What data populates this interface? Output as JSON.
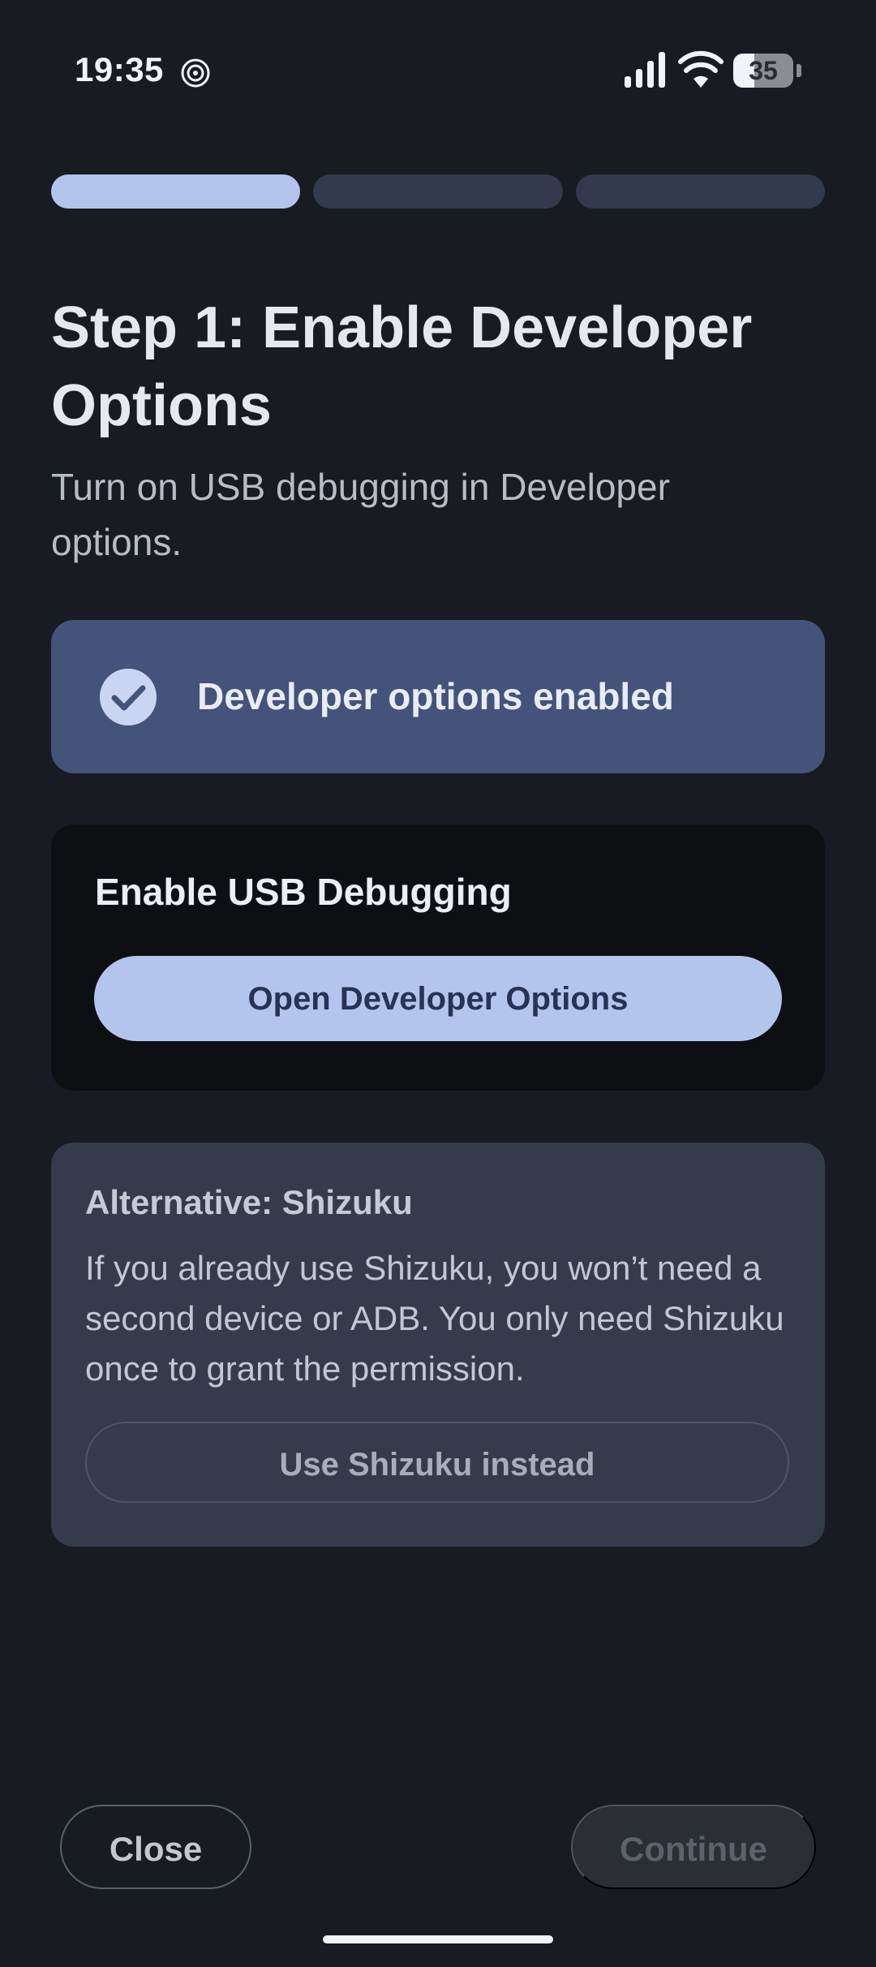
{
  "status_bar": {
    "time": "19:35",
    "battery_level": "35",
    "battery_fraction": 0.35,
    "icons": [
      "spiral-icon",
      "signal-icon",
      "wifi-icon",
      "battery-icon"
    ]
  },
  "progress": {
    "total_steps": 3,
    "current_step": 1
  },
  "header": {
    "title": "Step 1: Enable Developer Options",
    "subtitle": "Turn on USB debugging in Developer options."
  },
  "enabled_card": {
    "icon": "check-circle-icon",
    "label": "Developer options enabled"
  },
  "usb_card": {
    "title": "Enable USB Debugging",
    "button_label": "Open Developer Options"
  },
  "shizuku_card": {
    "title": "Alternative: Shizuku",
    "body": "If you already use Shizuku, you won’t need a second device or ADB. You only need Shizuku once to grant the permission.",
    "button_label": "Use Shizuku instead"
  },
  "footer": {
    "close_label": "Close",
    "continue_label": "Continue"
  },
  "colors": {
    "background": "#181b21",
    "accent": "#b4c5ed",
    "enabled_card": "#44537a",
    "alt_card": "#363b4c"
  }
}
